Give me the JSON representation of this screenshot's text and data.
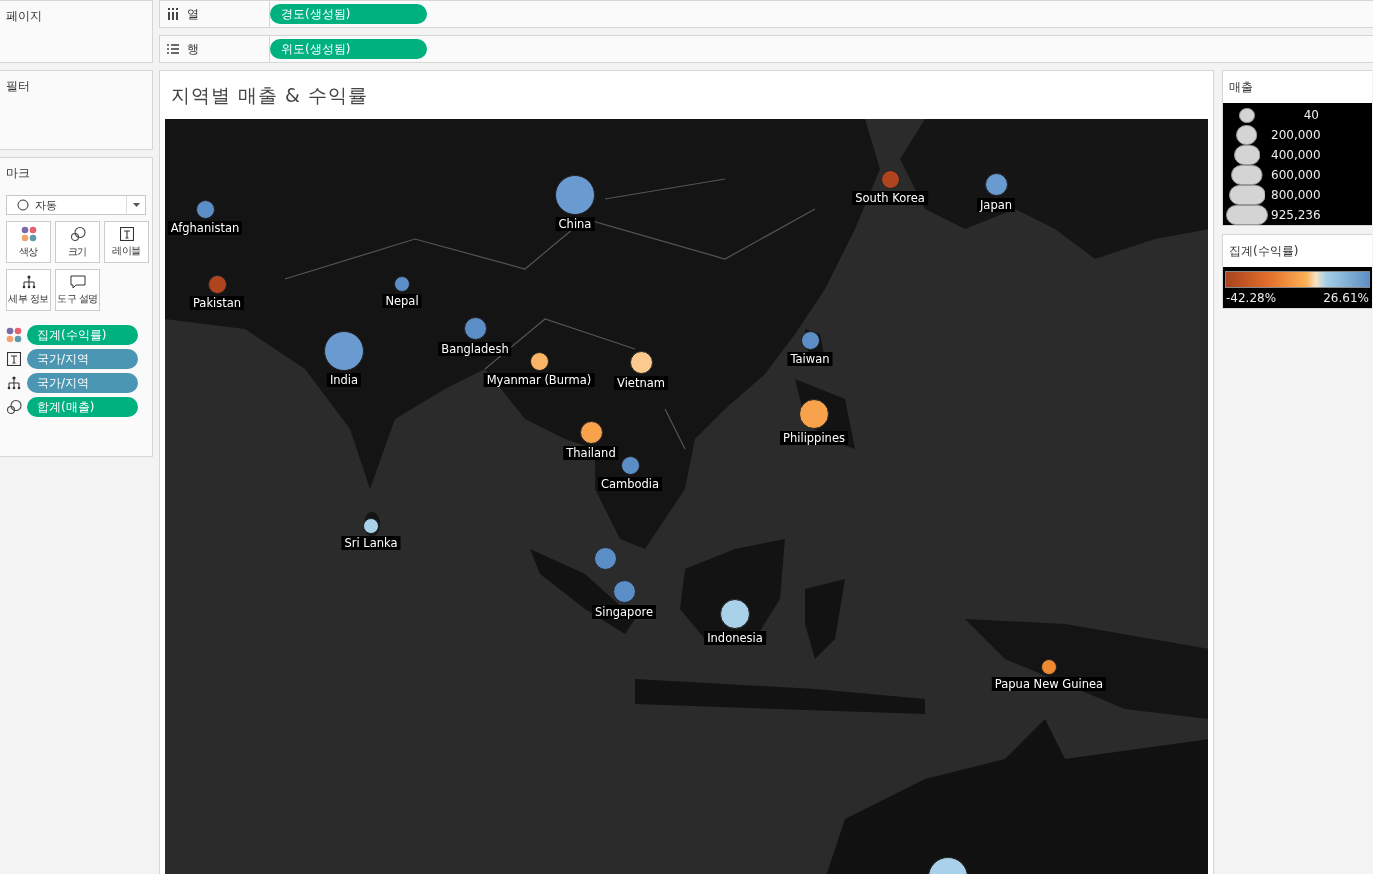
{
  "pages": {
    "title": "페이지"
  },
  "shelves": [
    {
      "kind": "columns",
      "label": "열",
      "pill": "경도(생성됨)"
    },
    {
      "kind": "rows",
      "label": "행",
      "pill": "위도(생성됨)"
    }
  ],
  "filters": {
    "title": "필터"
  },
  "marks": {
    "title": "마크",
    "mark_type": "자동",
    "buttons": [
      {
        "kind": "color",
        "label": "색상"
      },
      {
        "kind": "size",
        "label": "크기"
      },
      {
        "kind": "label",
        "label": "레이블"
      },
      {
        "kind": "detail",
        "label": "세부 정보"
      },
      {
        "kind": "tooltip",
        "label": "도구 설명"
      }
    ],
    "pills": [
      {
        "kind": "color",
        "color": "#00b180",
        "label": "집계(수익률)"
      },
      {
        "kind": "label",
        "color": "#4b96b2",
        "label": "국가/지역"
      },
      {
        "kind": "detail",
        "color": "#4b96b2",
        "label": "국가/지역"
      },
      {
        "kind": "size",
        "color": "#00b180",
        "label": "합계(매출)"
      }
    ]
  },
  "view": {
    "title": "지역별 매출 & 수익률",
    "markers": [
      {
        "label": "Afghanistan",
        "color": "#5b8ec6",
        "kind": "small"
      },
      {
        "label": "China",
        "color": "#6a9bd0",
        "kind": "xlarge"
      },
      {
        "label": "South Korea",
        "color": "#b0441f",
        "kind": "small"
      },
      {
        "label": "Japan",
        "color": "#6a9bd0",
        "kind": "medium"
      },
      {
        "label": "Pakistan",
        "color": "#b0441f",
        "kind": "small"
      },
      {
        "label": "Nepal",
        "color": "#5b8ec6",
        "kind": "tiny"
      },
      {
        "label": "India",
        "color": "#6a9bd0",
        "kind": "xlarge"
      },
      {
        "label": "Bangladesh",
        "color": "#5b8ec6",
        "kind": "medium"
      },
      {
        "label": "Myanmar (Burma)",
        "color": "#fbb466",
        "kind": "small"
      },
      {
        "label": "Vietnam",
        "color": "#fcca8e",
        "kind": "medium"
      },
      {
        "label": "Taiwan",
        "color": "#5b8ec6",
        "kind": "small"
      },
      {
        "label": "Thailand",
        "color": "#f8a24b",
        "kind": "medium"
      },
      {
        "label": "Philippines",
        "color": "#f8a24b",
        "kind": "large"
      },
      {
        "label": "Cambodia",
        "color": "#5b8ec6",
        "kind": "small"
      },
      {
        "label": "Sri Lanka",
        "color": "#a9d1ea",
        "kind": "tiny"
      },
      {
        "color": "#5b8ec6",
        "kind": "medium"
      },
      {
        "label": "Singapore",
        "color": "#5b8ec6",
        "kind": "medium"
      },
      {
        "label": "Indonesia",
        "color": "#a9d1ea",
        "kind": "large"
      },
      {
        "label": "Papua New Guinea",
        "color": "#f08a32",
        "kind": "tiny"
      },
      {
        "color": "#a9d1ea",
        "kind": "xlarge"
      }
    ]
  },
  "size_legend": {
    "title": "매출",
    "items": [
      "40",
      "200,000",
      "400,000",
      "600,000",
      "800,000",
      "925,236"
    ]
  },
  "color_legend": {
    "title": "집계(수익률)",
    "min": "-42.28%",
    "max": "26.61%"
  }
}
